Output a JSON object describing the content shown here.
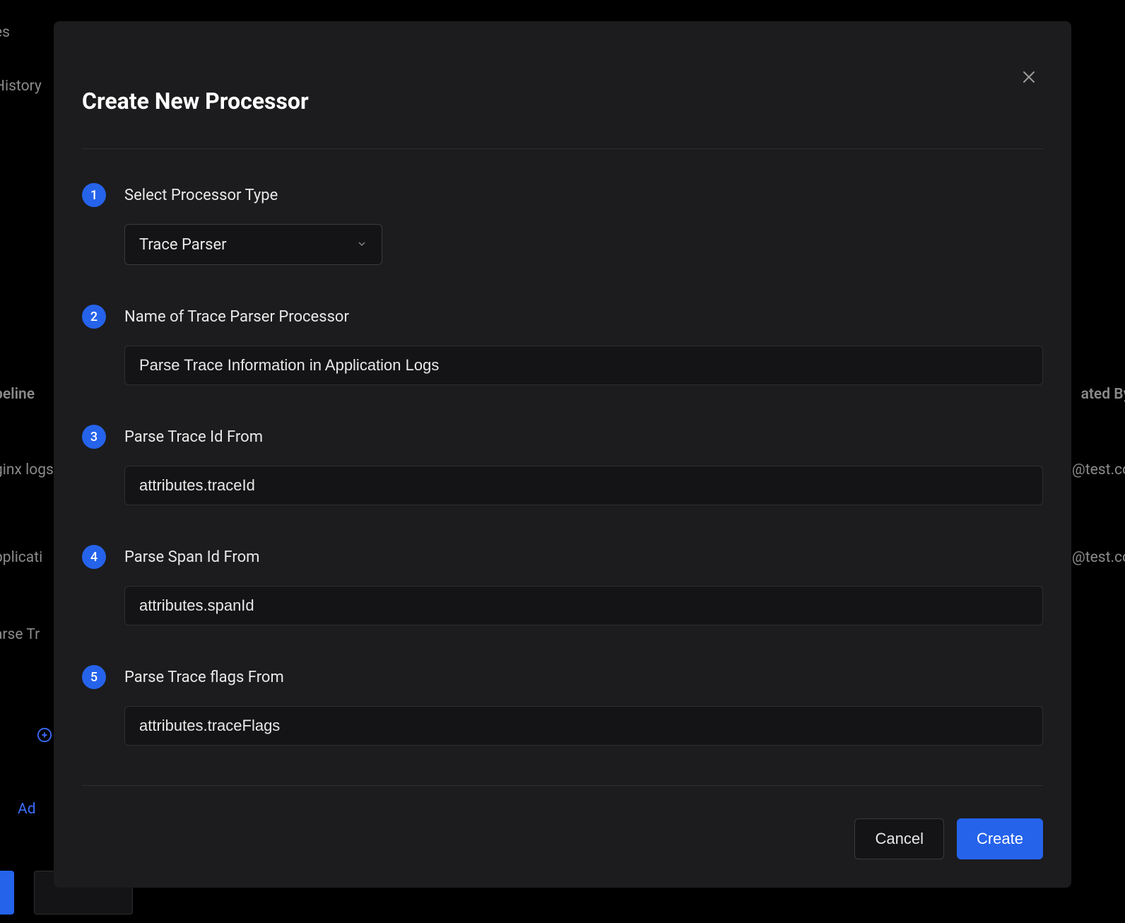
{
  "modal": {
    "title": "Create New Processor",
    "steps": {
      "s1": {
        "num": "1",
        "label": "Select Processor Type",
        "select_value": "Trace Parser"
      },
      "s2": {
        "num": "2",
        "label": "Name of Trace Parser Processor",
        "value": "Parse Trace Information in Application Logs"
      },
      "s3": {
        "num": "3",
        "label": "Parse Trace Id From",
        "value": "attributes.traceId"
      },
      "s4": {
        "num": "4",
        "label": "Parse Span Id From",
        "value": "attributes.spanId"
      },
      "s5": {
        "num": "5",
        "label": "Parse Trace flags From",
        "value": "attributes.traceFlags"
      }
    },
    "cancel": "Cancel",
    "create": "Create"
  },
  "bg": {
    "frag1": "es",
    "frag2": "History",
    "col_pipeline": "peline",
    "col_created": "ated By",
    "row1": "ginx logs",
    "row2": "pplicati",
    "row3": "arse Tr",
    "email1": "@test.co",
    "email2": "@test.co",
    "add": "Ad"
  }
}
